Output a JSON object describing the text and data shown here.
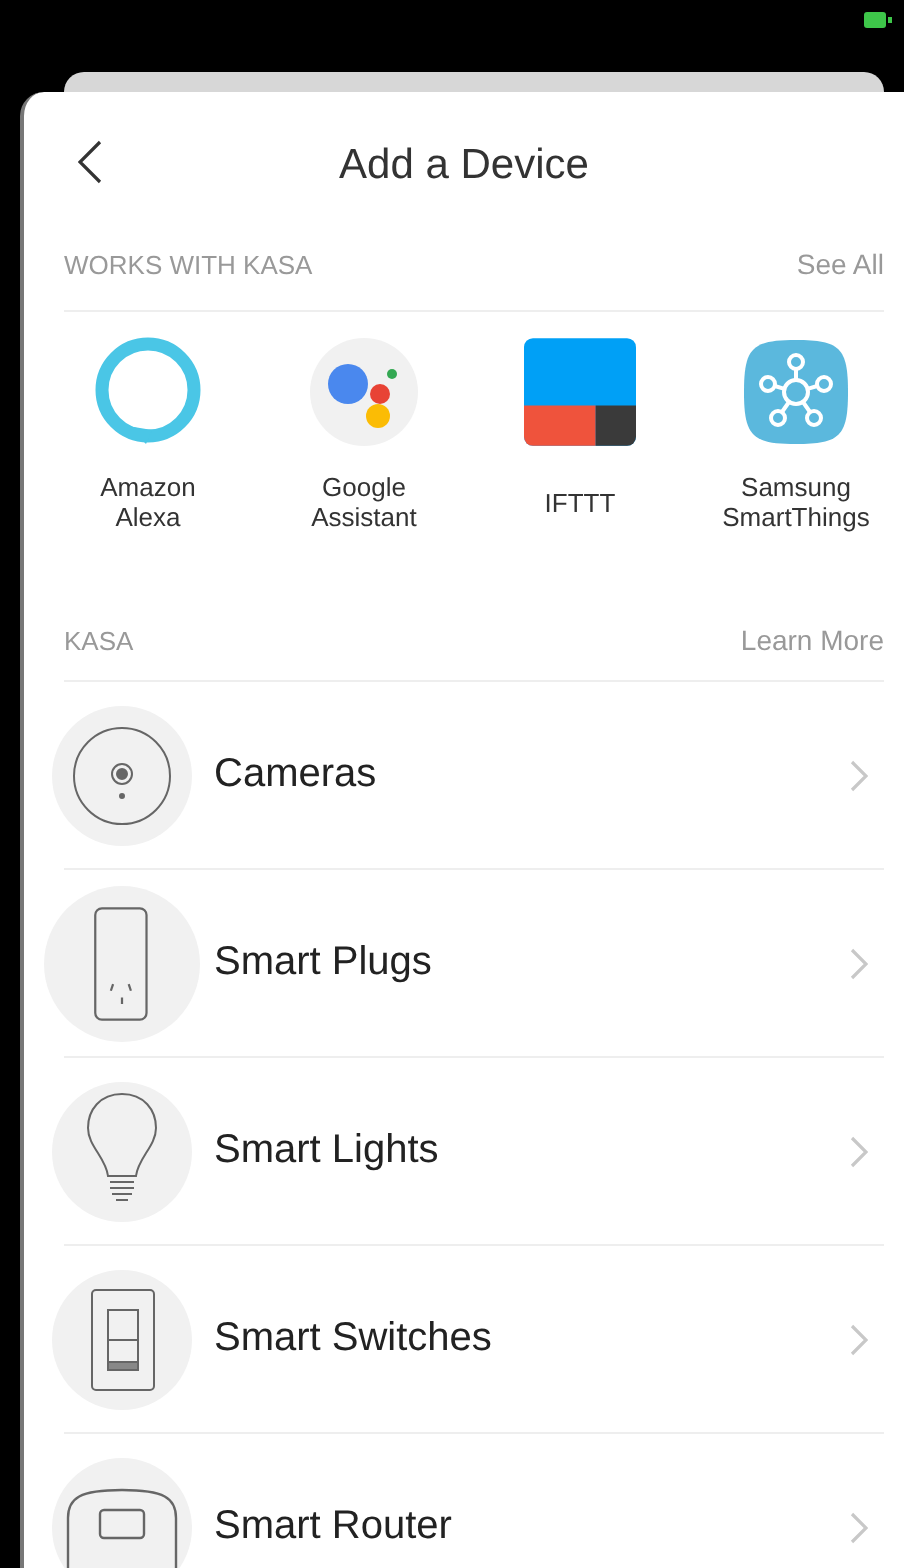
{
  "header": {
    "title": "Add a Device"
  },
  "works_with": {
    "heading": "WORKS WITH KASA",
    "action": "See All",
    "items": [
      {
        "kind": "alexa",
        "label": "Amazon\nAlexa"
      },
      {
        "kind": "assistant",
        "label": "Google\nAssistant"
      },
      {
        "kind": "ifttt",
        "label": "IFTTT"
      },
      {
        "kind": "smartthings",
        "label": "Samsung\nSmartThings"
      }
    ]
  },
  "kasa": {
    "heading": "KASA",
    "action": "Learn More",
    "items": [
      {
        "kind": "camera",
        "label": "Cameras"
      },
      {
        "kind": "plug",
        "label": "Smart Plugs"
      },
      {
        "kind": "bulb",
        "label": "Smart Lights"
      },
      {
        "kind": "switch",
        "label": "Smart Switches"
      },
      {
        "kind": "router",
        "label": "Smart Router"
      }
    ]
  }
}
